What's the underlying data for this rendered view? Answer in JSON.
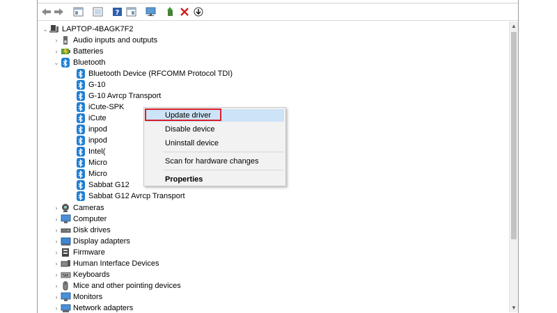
{
  "tree": {
    "root": "LAPTOP-4BAGK7F2",
    "categories_top": [
      {
        "label": "Audio inputs and outputs",
        "icon": "speaker-icon"
      },
      {
        "label": "Batteries",
        "icon": "battery-icon"
      }
    ],
    "bluetooth": {
      "label": "Bluetooth",
      "children": [
        "Bluetooth Device (RFCOMM Protocol TDI)",
        "G-10",
        "G-10 Avrcp Transport",
        "iCute-SPK",
        "iCute",
        "inpod",
        "inpod",
        "Intel(",
        "Micro",
        "Micro",
        "Sabbat G12",
        "Sabbat G12 Avrcp Transport"
      ]
    },
    "categories_bottom": [
      {
        "label": "Cameras",
        "icon": "camera-icon"
      },
      {
        "label": "Computer",
        "icon": "computer-icon"
      },
      {
        "label": "Disk drives",
        "icon": "disk-drive-icon"
      },
      {
        "label": "Display adapters",
        "icon": "display-adapter-icon"
      },
      {
        "label": "Firmware",
        "icon": "firmware-icon"
      },
      {
        "label": "Human Interface Devices",
        "icon": "hid-icon"
      },
      {
        "label": "Keyboards",
        "icon": "keyboard-icon"
      },
      {
        "label": "Mice and other pointing devices",
        "icon": "mouse-icon"
      },
      {
        "label": "Monitors",
        "icon": "monitor-icon"
      },
      {
        "label": "Network adapters",
        "icon": "network-adapter-icon"
      }
    ]
  },
  "context_menu": {
    "update_driver": "Update driver",
    "disable_device": "Disable device",
    "uninstall_device": "Uninstall device",
    "scan_hardware": "Scan for hardware changes",
    "properties": "Properties"
  },
  "colors": {
    "highlight_box": "#d6202a",
    "menu_hover": "#cde3f7",
    "bluetooth_blue": "#1e7fd4"
  }
}
